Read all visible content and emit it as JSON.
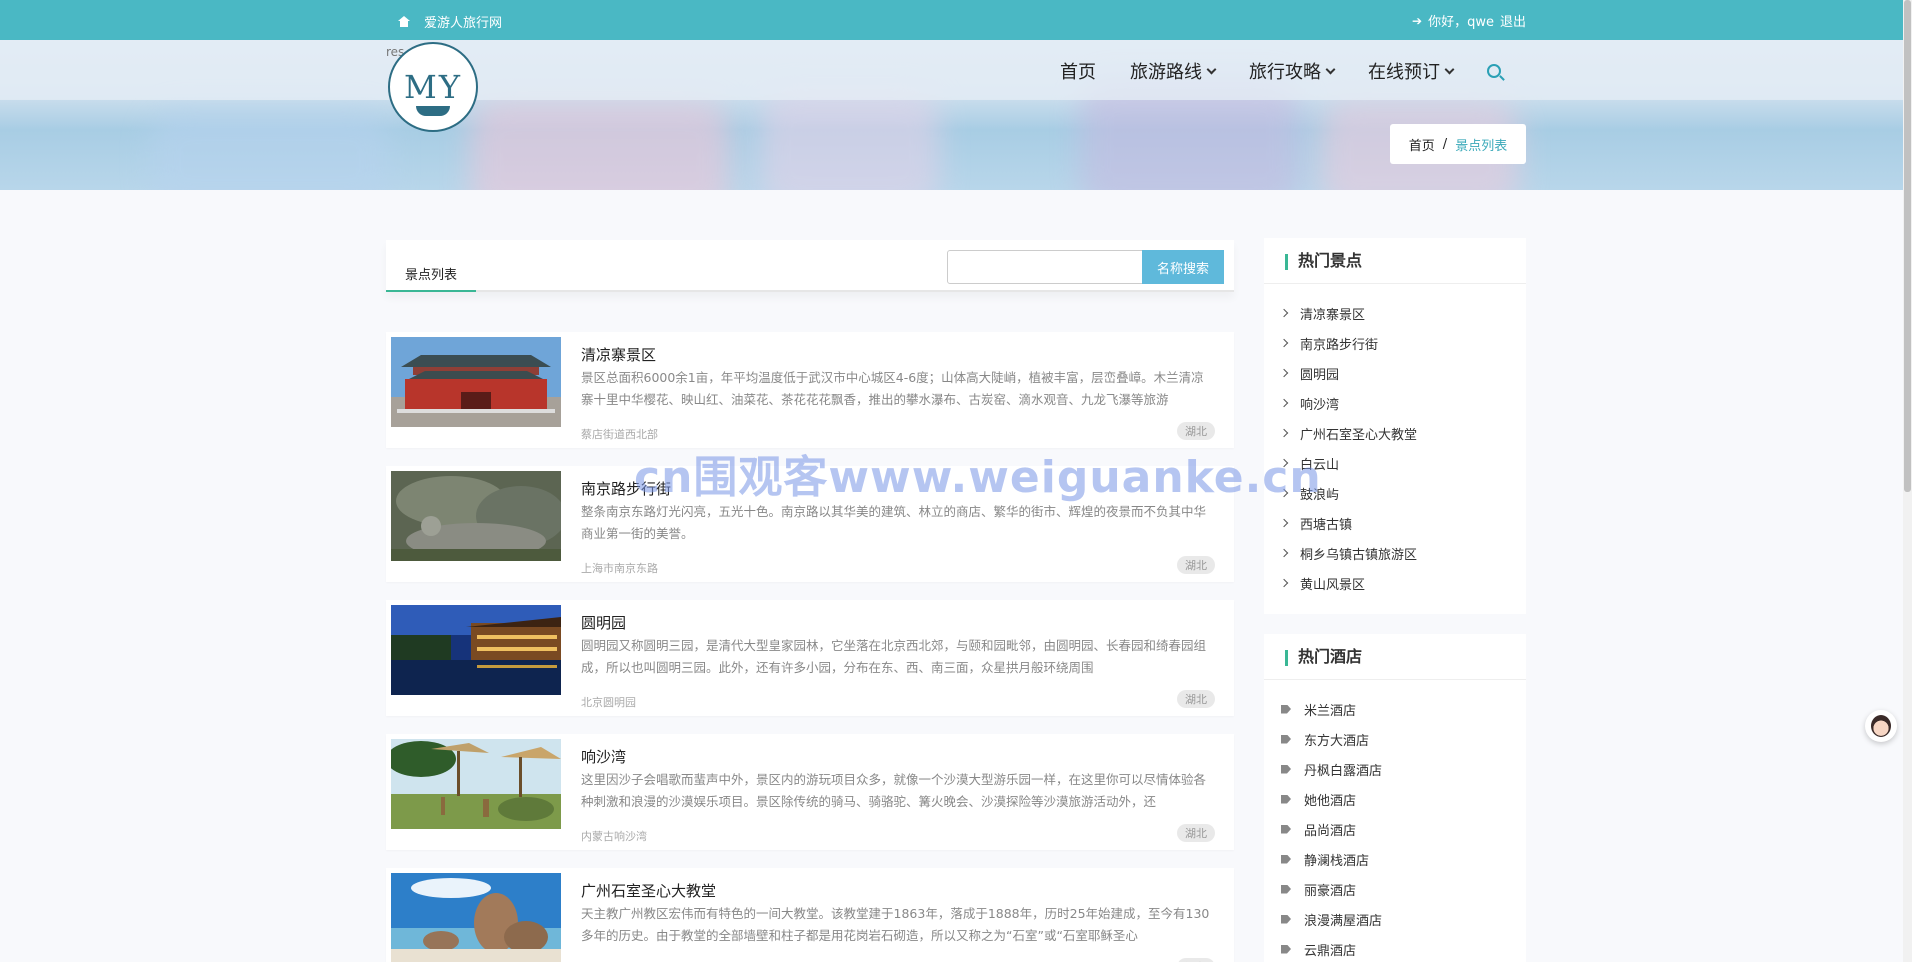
{
  "topbar": {
    "site_name": "爱游人旅行网",
    "greeting": "你好，qwe",
    "logout": "退出"
  },
  "header": {
    "res_text": "res",
    "logo_text": "MY",
    "nav": [
      {
        "label": "首页",
        "dropdown": false
      },
      {
        "label": "旅游路线",
        "dropdown": true
      },
      {
        "label": "旅行攻略",
        "dropdown": true
      },
      {
        "label": "在线预订",
        "dropdown": true
      }
    ],
    "breadcrumb": {
      "home": "首页",
      "sep": "/",
      "current": "景点列表"
    }
  },
  "main": {
    "tab_label": "景点列表",
    "search_placeholder": "",
    "search_button": "名称搜索",
    "items": [
      {
        "title": "清凉寨景区",
        "desc": "景区总面积6000余1亩，年平均温度低于武汉市中心城区4-6度；山体高大陡峭，植被丰富，层峦叠嶂。木兰清凉寨十里中华樱花、映山红、油菜花、茶花花花飘香，推出的攀水瀑布、古炭窑、滴水观音、九龙飞瀑等旅游",
        "addr": "蔡店街道西北部",
        "tag": "湖北",
        "thumb": "palace"
      },
      {
        "title": "南京路步行街",
        "desc": "整条南京东路灯光闪亮，五光十色。南京路以其华美的建筑、林立的商店、繁华的街市、辉煌的夜景而不负其中华商业第一街的美誉。",
        "addr": "上海市南京东路",
        "tag": "湖北",
        "thumb": "rock"
      },
      {
        "title": "圆明园",
        "desc": "圆明园又称圆明三园，是清代大型皇家园林，它坐落在北京西北郊，与颐和园毗邻，由圆明园、长春园和绮春园组成，所以也叫圆明三园。此外，还有许多小园，分布在东、西、南三面，众星拱月般环绕周围",
        "addr": "北京圆明园",
        "tag": "湖北",
        "thumb": "night"
      },
      {
        "title": "响沙湾",
        "desc": "这里因沙子会唱歌而蜚声中外，景区内的游玩项目众多，就像一个沙漠大型游乐园一样，在这里你可以尽情体验各种刺激和浪漫的沙漠娱乐项目。景区除传统的骑马、骑骆驼、篝火晚会、沙漠探险等沙漠旅游活动外，还",
        "addr": "内蒙古响沙湾",
        "tag": "湖北",
        "thumb": "desert"
      },
      {
        "title": "广州石室圣心大教堂",
        "desc": "天主教广州教区宏伟而有特色的一间大教堂。该教堂建于1863年，落成于1888年，历时25年始建成，至今有130多年的历史。由于教堂的全部墙壁和柱子都是用花岗岩石砌造，所以又称之为“石室”或“石室耶稣圣心",
        "addr": "",
        "tag": "湖北",
        "thumb": "beach"
      }
    ]
  },
  "sidebar": {
    "hot_spots_title": "热门景点",
    "hot_spots": [
      "清凉寨景区",
      "南京路步行街",
      "圆明园",
      "响沙湾",
      "广州石室圣心大教堂",
      "白云山",
      "鼓浪屿",
      "西塘古镇",
      "桐乡乌镇古镇旅游区",
      "黄山风景区"
    ],
    "hot_hotels_title": "热门酒店",
    "hot_hotels": [
      "米兰酒店",
      "东方大酒店",
      "丹枫白露酒店",
      "她他酒店",
      "品尚酒店",
      "静澜栈酒店",
      "丽豪酒店",
      "浪漫满屋酒店",
      "云鼎酒店"
    ]
  },
  "watermark": "cn围观客www.weiguanke.cn",
  "colors": {
    "topbar": "#4ab8c4",
    "accent": "#3ab795",
    "search_button": "#5fb9db"
  }
}
